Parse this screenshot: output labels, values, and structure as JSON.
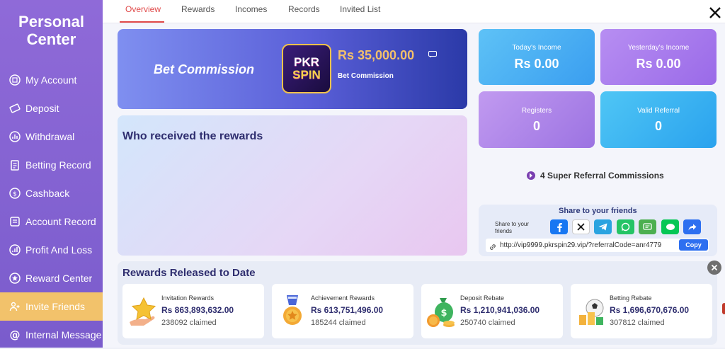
{
  "sidebar": {
    "title": "Personal\nCenter",
    "items": [
      {
        "label": "My Account"
      },
      {
        "label": "Deposit"
      },
      {
        "label": "Withdrawal"
      },
      {
        "label": "Betting Record"
      },
      {
        "label": "Cashback"
      },
      {
        "label": "Account Record"
      },
      {
        "label": "Profit And Loss"
      },
      {
        "label": "Reward Center"
      },
      {
        "label": "Invite Friends",
        "active": true
      },
      {
        "label": "Internal Message"
      }
    ]
  },
  "tabs": [
    {
      "label": "Overview",
      "active": true
    },
    {
      "label": "Rewards"
    },
    {
      "label": "Incomes"
    },
    {
      "label": "Records"
    },
    {
      "label": "Invited List"
    }
  ],
  "bet_commission": {
    "title": "Bet Commission",
    "logo_top": "PKR",
    "logo_bottom": "SPIN",
    "amount": "Rs  35,000.00",
    "sub_label": "Bet Commission"
  },
  "who": {
    "title": "Who received the rewards"
  },
  "stats": {
    "today": {
      "label": "Today's Income",
      "value": "Rs  0.00"
    },
    "yesterday": {
      "label": "Yesterday's Income",
      "value": "Rs  0.00"
    },
    "registers": {
      "label": "Registers",
      "value": "0"
    },
    "valid_referral": {
      "label": "Valid Referral",
      "value": "0"
    }
  },
  "super_referral": "4 Super Referral Commissions",
  "share": {
    "title": "Share to your friends",
    "sub": "Share to your\nfriends",
    "buttons": [
      "facebook-icon",
      "x-icon",
      "telegram-icon",
      "whatsapp-icon",
      "sms-icon",
      "line-icon",
      "share-icon"
    ],
    "link": "http://vip9999.pkrspin29.vip/?referralCode=anr4779",
    "copy_label": "Copy"
  },
  "rewards": {
    "title": "Rewards Released to Date",
    "items": [
      {
        "label": "Invitation Rewards",
        "amount": "Rs  863,893,632.00",
        "claimed": "238092 claimed"
      },
      {
        "label": "Achievement Rewards",
        "amount": "Rs  613,751,496.00",
        "claimed": "185244 claimed"
      },
      {
        "label": "Deposit Rebate",
        "amount": "Rs  1,210,941,036.00",
        "claimed": "250740 claimed"
      },
      {
        "label": "Betting Rebate",
        "amount": "Rs  1,696,670,676.00",
        "claimed": "307812 claimed"
      }
    ]
  },
  "colors": {
    "accent": "#e04a4a",
    "sidebar": "#8a66d4",
    "active_nav": "#f2c26b",
    "title_text": "#2f2e6f"
  }
}
